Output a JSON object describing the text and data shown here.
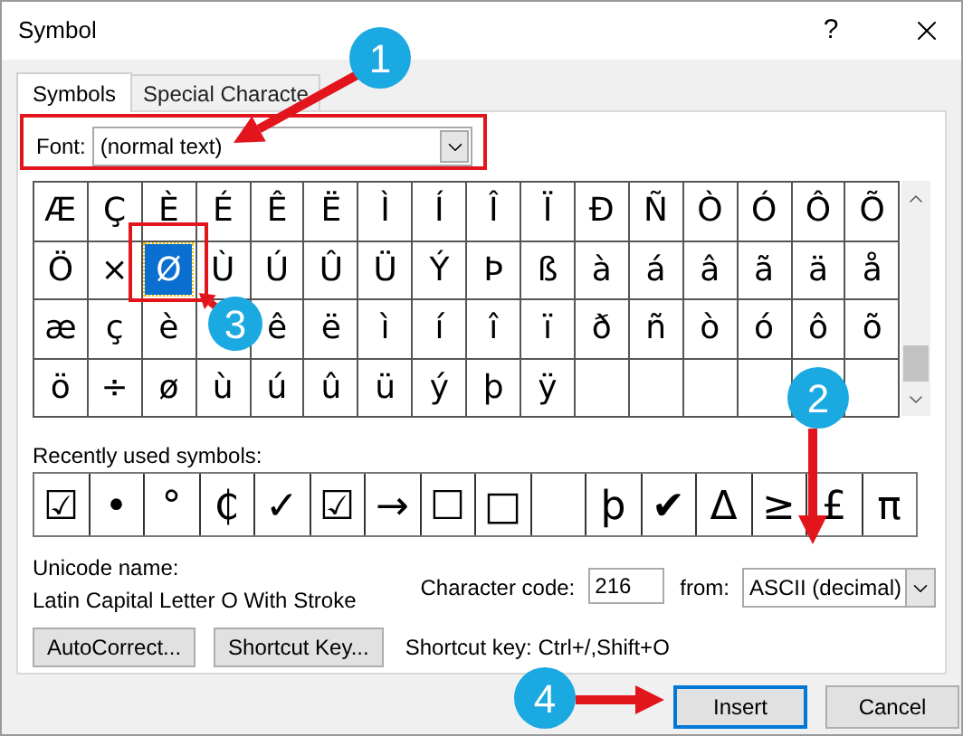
{
  "window": {
    "title": "Symbol",
    "help": "?"
  },
  "tabs": [
    {
      "label": "Symbols",
      "selected": true
    },
    {
      "label": "Special Characte",
      "selected": false
    }
  ],
  "font": {
    "label": "Font:",
    "value": "(normal text)"
  },
  "symbols": [
    [
      {
        "kind": "symbol",
        "char": "Æ",
        "selected": false
      },
      {
        "kind": "symbol",
        "char": "Ç",
        "selected": false
      },
      {
        "kind": "symbol",
        "char": "È",
        "selected": false
      },
      {
        "kind": "symbol",
        "char": "É",
        "selected": false
      },
      {
        "kind": "symbol",
        "char": "Ê",
        "selected": false
      },
      {
        "kind": "symbol",
        "char": "Ë",
        "selected": false
      },
      {
        "kind": "symbol",
        "char": "Ì",
        "selected": false
      },
      {
        "kind": "symbol",
        "char": "Í",
        "selected": false
      },
      {
        "kind": "symbol",
        "char": "Î",
        "selected": false
      },
      {
        "kind": "symbol",
        "char": "Ï",
        "selected": false
      },
      {
        "kind": "symbol",
        "char": "Ð",
        "selected": false
      },
      {
        "kind": "symbol",
        "char": "Ñ",
        "selected": false
      },
      {
        "kind": "symbol",
        "char": "Ò",
        "selected": false
      },
      {
        "kind": "symbol",
        "char": "Ó",
        "selected": false
      },
      {
        "kind": "symbol",
        "char": "Ô",
        "selected": false
      },
      {
        "kind": "symbol",
        "char": "Õ",
        "selected": false
      }
    ],
    [
      {
        "kind": "symbol",
        "char": "Ö",
        "selected": false
      },
      {
        "kind": "symbol",
        "char": "×",
        "selected": false
      },
      {
        "kind": "symbol",
        "char": "Ø",
        "selected": true
      },
      {
        "kind": "symbol",
        "char": "Ù",
        "selected": false
      },
      {
        "kind": "symbol",
        "char": "Ú",
        "selected": false
      },
      {
        "kind": "symbol",
        "char": "Û",
        "selected": false
      },
      {
        "kind": "symbol",
        "char": "Ü",
        "selected": false
      },
      {
        "kind": "symbol",
        "char": "Ý",
        "selected": false
      },
      {
        "kind": "symbol",
        "char": "Þ",
        "selected": false
      },
      {
        "kind": "symbol",
        "char": "ß",
        "selected": false
      },
      {
        "kind": "symbol",
        "char": "à",
        "selected": false
      },
      {
        "kind": "symbol",
        "char": "á",
        "selected": false
      },
      {
        "kind": "symbol",
        "char": "â",
        "selected": false
      },
      {
        "kind": "symbol",
        "char": "ã",
        "selected": false
      },
      {
        "kind": "symbol",
        "char": "ä",
        "selected": false
      },
      {
        "kind": "symbol",
        "char": "å",
        "selected": false
      }
    ],
    [
      {
        "kind": "symbol",
        "char": "æ",
        "selected": false
      },
      {
        "kind": "symbol",
        "char": "ç",
        "selected": false
      },
      {
        "kind": "symbol",
        "char": "è",
        "selected": false
      },
      {
        "kind": "covered"
      },
      {
        "kind": "symbol",
        "char": "ê",
        "selected": false
      },
      {
        "kind": "symbol",
        "char": "ë",
        "selected": false
      },
      {
        "kind": "symbol",
        "char": "ì",
        "selected": false
      },
      {
        "kind": "symbol",
        "char": "í",
        "selected": false
      },
      {
        "kind": "symbol",
        "char": "î",
        "selected": false
      },
      {
        "kind": "symbol",
        "char": "ï",
        "selected": false
      },
      {
        "kind": "symbol",
        "char": "ð",
        "selected": false
      },
      {
        "kind": "symbol",
        "char": "ñ",
        "selected": false
      },
      {
        "kind": "symbol",
        "char": "ò",
        "selected": false
      },
      {
        "kind": "symbol",
        "char": "ó",
        "selected": false
      },
      {
        "kind": "symbol",
        "char": "ô",
        "selected": false
      },
      {
        "kind": "symbol",
        "char": "õ",
        "selected": false
      }
    ],
    [
      {
        "kind": "symbol",
        "char": "ö",
        "selected": false
      },
      {
        "kind": "symbol",
        "char": "÷",
        "selected": false
      },
      {
        "kind": "symbol",
        "char": "ø",
        "selected": false
      },
      {
        "kind": "symbol",
        "char": "ù",
        "selected": false
      },
      {
        "kind": "symbol",
        "char": "ú",
        "selected": false
      },
      {
        "kind": "symbol",
        "char": "û",
        "selected": false
      },
      {
        "kind": "symbol",
        "char": "ü",
        "selected": false
      },
      {
        "kind": "symbol",
        "char": "ý",
        "selected": false
      },
      {
        "kind": "symbol",
        "char": "þ",
        "selected": false
      },
      {
        "kind": "symbol",
        "char": "ÿ",
        "selected": false
      }
    ]
  ],
  "recent": {
    "label": "Recently used symbols:",
    "symbols": [
      {
        "kind": "symbol",
        "char": "☑"
      },
      {
        "kind": "symbol",
        "char": "•"
      },
      {
        "kind": "symbol",
        "char": "°"
      },
      {
        "kind": "symbol",
        "char": "₵"
      },
      {
        "kind": "symbol",
        "char": "✓"
      },
      {
        "kind": "symbol",
        "char": "☑"
      },
      {
        "kind": "symbol",
        "char": "→"
      },
      {
        "kind": "symbol",
        "char": "☐"
      },
      {
        "kind": "symbol",
        "char": "□"
      },
      {
        "kind": "blank"
      },
      {
        "kind": "symbol",
        "char": "þ"
      },
      {
        "kind": "symbol",
        "char": "✔"
      },
      {
        "kind": "symbol",
        "char": "Δ"
      },
      {
        "kind": "symbol",
        "char": "≥"
      },
      {
        "kind": "symbol",
        "char": "£"
      },
      {
        "kind": "symbol",
        "char": "π"
      }
    ]
  },
  "unicode_name": {
    "label": "Unicode name:",
    "value": "Latin Capital Letter O With Stroke"
  },
  "character_code": {
    "label": "Character code:",
    "value": "216"
  },
  "from": {
    "label": "from:",
    "value": "ASCII (decimal)"
  },
  "buttons": [
    "AutoCorrect...",
    "Shortcut Key..."
  ],
  "shortcut_key": "Shortcut key: Ctrl+/,Shift+O",
  "dialog_buttons": [
    {
      "label": "Insert",
      "default": true
    },
    {
      "label": "Cancel",
      "default": false
    }
  ],
  "annotations": [
    {
      "label": "1"
    },
    {
      "label": "2"
    },
    {
      "label": "3"
    },
    {
      "label": "4"
    }
  ]
}
